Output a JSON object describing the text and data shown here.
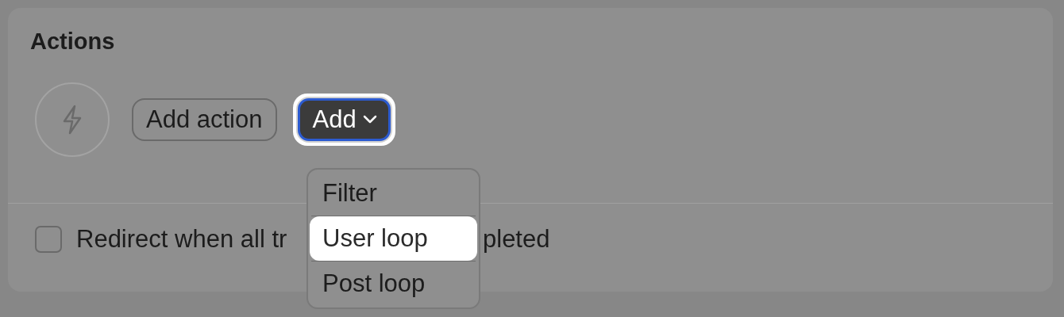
{
  "card": {
    "title": "Actions"
  },
  "add_action_button": {
    "label": "Add action"
  },
  "add_button": {
    "label": "Add",
    "focused": true
  },
  "menu": {
    "items": [
      {
        "label": "Filter",
        "selected": false
      },
      {
        "label": "User loop",
        "selected": true
      },
      {
        "label": "Post loop",
        "selected": false
      }
    ]
  },
  "checkbox": {
    "checked": false,
    "label_before": "Redirect when all tr",
    "label_after": "pleted"
  }
}
